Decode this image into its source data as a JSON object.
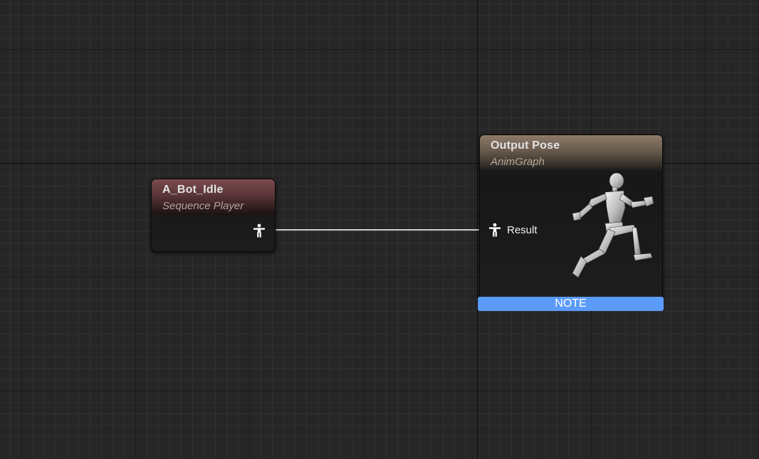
{
  "graph": {
    "nodes": {
      "sequence_player": {
        "title": "A_Bot_Idle",
        "subtitle": "Sequence Player",
        "header_color": "#7a4b4e",
        "output_pin_icon": "pose-pin-icon"
      },
      "output_pose": {
        "title": "Output Pose",
        "subtitle": "AnimGraph",
        "header_color": "#8d7a68",
        "input_pin_icon": "pose-pin-icon",
        "input_pin_label": "Result",
        "preview_icon": "running-mannequin-icon"
      }
    },
    "note": {
      "label": "NOTE",
      "color": "#5b9bfa"
    },
    "wire_color": "#cfcfcf",
    "background_color": "#262626"
  }
}
